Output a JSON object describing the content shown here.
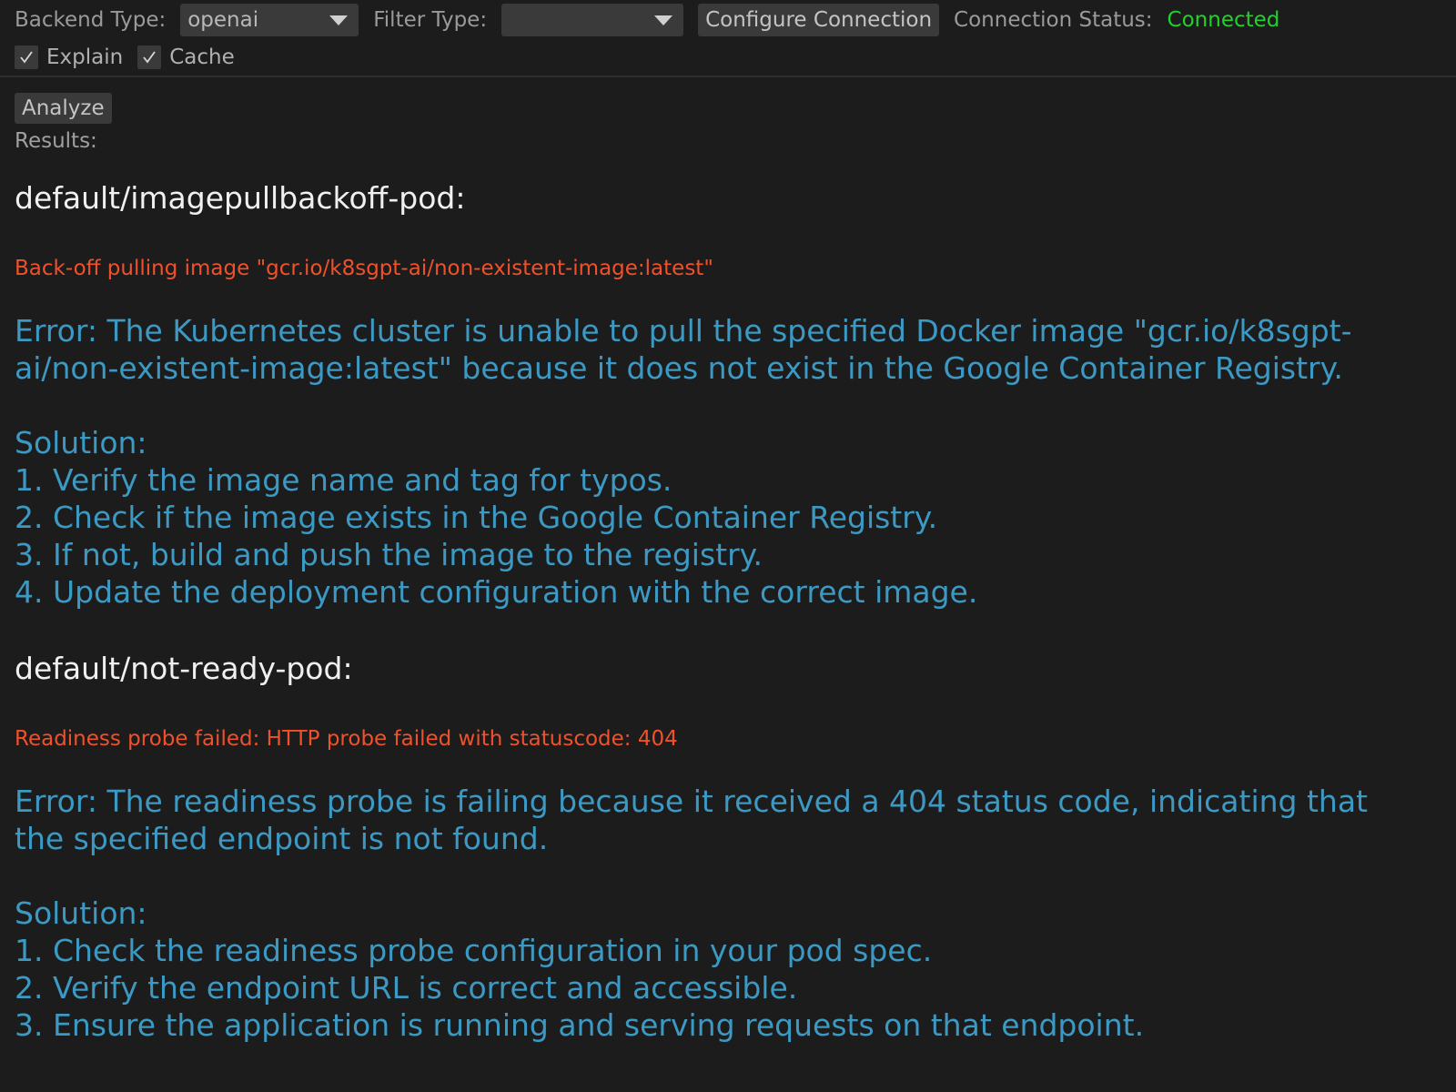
{
  "toolbar": {
    "backend_label": "Backend Type:",
    "backend_value": "openai",
    "filter_label": "Filter Type:",
    "filter_value": "",
    "configure_label": "Configure Connection",
    "status_label": "Connection Status:",
    "status_value": "Connected",
    "status_color": "#22d12a"
  },
  "options": {
    "explain_label": "Explain",
    "explain_checked": true,
    "cache_label": "Cache",
    "cache_checked": true
  },
  "actions": {
    "analyze_label": "Analyze",
    "results_label": "Results:"
  },
  "results": [
    {
      "name": "default/imagepullbackoff-pod:",
      "error": "Back-off pulling image \"gcr.io/k8sgpt-ai/non-existent-image:latest\"",
      "explanation": "Error: The Kubernetes cluster is unable to pull the specified Docker image \"gcr.io/k8sgpt-ai/non-existent-image:latest\" because it does not exist in the Google Container Registry.\n\nSolution:\n1. Verify the image name and tag for typos.\n2. Check if the image exists in the Google Container Registry.\n3. If not, build and push the image to the registry.\n4. Update the deployment configuration with the correct image."
    },
    {
      "name": "default/not-ready-pod:",
      "error": "Readiness probe failed: HTTP probe failed with statuscode: 404",
      "explanation": "Error: The readiness probe is failing because it received a 404 status code, indicating that the specified endpoint is not found.\n\nSolution:\n1. Check the readiness probe configuration in your pod spec.\n2. Verify the endpoint URL is correct and accessible.\n3. Ensure the application is running and serving requests on that endpoint."
    }
  ],
  "colors": {
    "background": "#1c1c1c",
    "error_text": "#f0512b",
    "explanation_text": "#3b99c3",
    "pod_name_text": "#f0f0f0"
  }
}
